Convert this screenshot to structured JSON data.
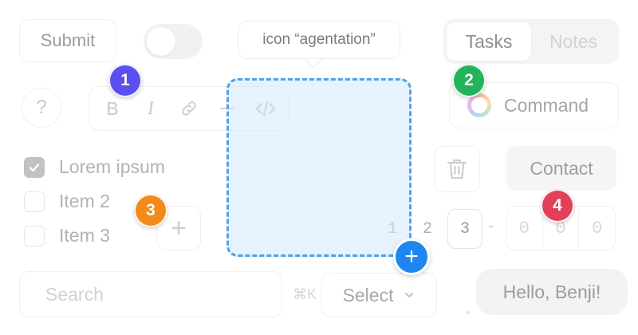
{
  "submit": {
    "label": "Submit"
  },
  "tooltip": {
    "text": "icon “agentation”"
  },
  "tabs": [
    {
      "label": "Tasks"
    },
    {
      "label": "Notes"
    }
  ],
  "help": {
    "glyph": "?"
  },
  "format_toolbar": {
    "bold": "B",
    "italic": "I"
  },
  "command": {
    "label": "Command"
  },
  "checkboxes": [
    {
      "label": "Lorem ipsum",
      "checked": true
    },
    {
      "label": "Item 2",
      "checked": false
    },
    {
      "label": "Item 3",
      "checked": false
    }
  ],
  "add_box": {
    "glyph": "+"
  },
  "contact": {
    "label": "Contact"
  },
  "pagination": {
    "pages": [
      "1",
      "2",
      "3"
    ],
    "current": "3",
    "separator": "-"
  },
  "otp": {
    "digits": [
      "0",
      "0",
      "0"
    ]
  },
  "search": {
    "placeholder": "Search",
    "shortcut": "⌘K"
  },
  "select": {
    "label": "Select"
  },
  "greeting": {
    "text": "Hello, Benji!"
  },
  "selection": {
    "add_glyph": "+"
  },
  "markers": [
    {
      "label": "1",
      "color": "#5b4ff0"
    },
    {
      "label": "2",
      "color": "#22b35b"
    },
    {
      "label": "3",
      "color": "#f28a1c"
    },
    {
      "label": "4",
      "color": "#e2405a"
    }
  ],
  "colors": {
    "selection_border": "#4da3ea",
    "selection_fill": "#d2e7fc",
    "selection_button": "#1f86f0"
  }
}
